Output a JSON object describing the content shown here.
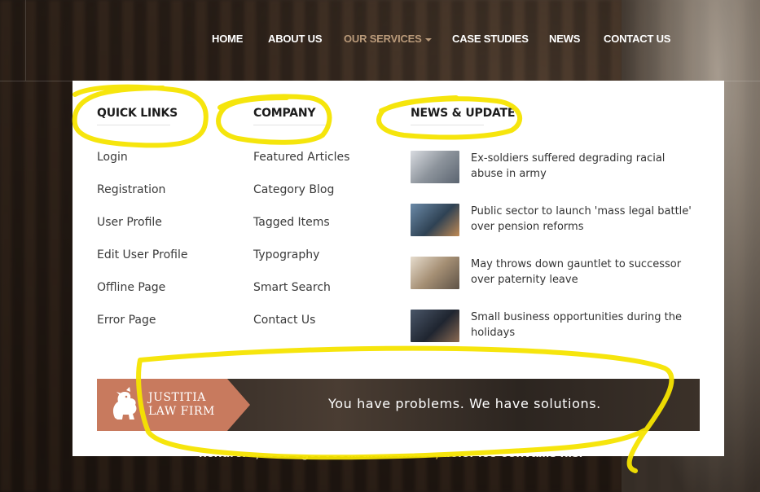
{
  "nav": {
    "items": [
      {
        "label": "HOME"
      },
      {
        "label": "ABOUT US"
      },
      {
        "label": "OUR SERVICES"
      },
      {
        "label": "CASE STUDIES"
      },
      {
        "label": "NEWS"
      },
      {
        "label": "CONTACT US"
      }
    ],
    "active_color": "#b99a7a"
  },
  "menu": {
    "quick_links": {
      "title": "QUICK LINKS",
      "items": [
        "Login",
        "Registration",
        "User Profile",
        "Edit User Profile",
        "Offline Page",
        "Error Page"
      ]
    },
    "company": {
      "title": "COMPANY",
      "items": [
        "Featured Articles",
        "Category Blog",
        "Tagged Items",
        "Typography",
        "Smart Search",
        "Contact Us"
      ]
    },
    "news": {
      "title": "NEWS & UPDATE",
      "items": [
        {
          "title": "Ex-soldiers suffered degrading racial abuse in army",
          "thumb_color": "#a9aeb4"
        },
        {
          "title": "Public sector to launch 'mass legal battle' over pension reforms",
          "thumb_color": "#3f5468"
        },
        {
          "title": "May throws down gauntlet to successor over paternity leave",
          "thumb_color": "#b8a58f"
        },
        {
          "title": "Small business opportunities during the holidays",
          "thumb_color": "#2f3847"
        }
      ]
    },
    "banner": {
      "brand_line1": "JUSTITIA",
      "brand_line2": "LAW FIRM",
      "slogan": "You have problems. We have solutions.",
      "accent_color": "#c87a5e"
    }
  },
  "background_text": {
    "before": "hendrerit, arcu eget vestibul",
    "highlight": "um mattis,",
    "after": " dolor leo convallis nis."
  },
  "annotation_color": "#f5e400"
}
